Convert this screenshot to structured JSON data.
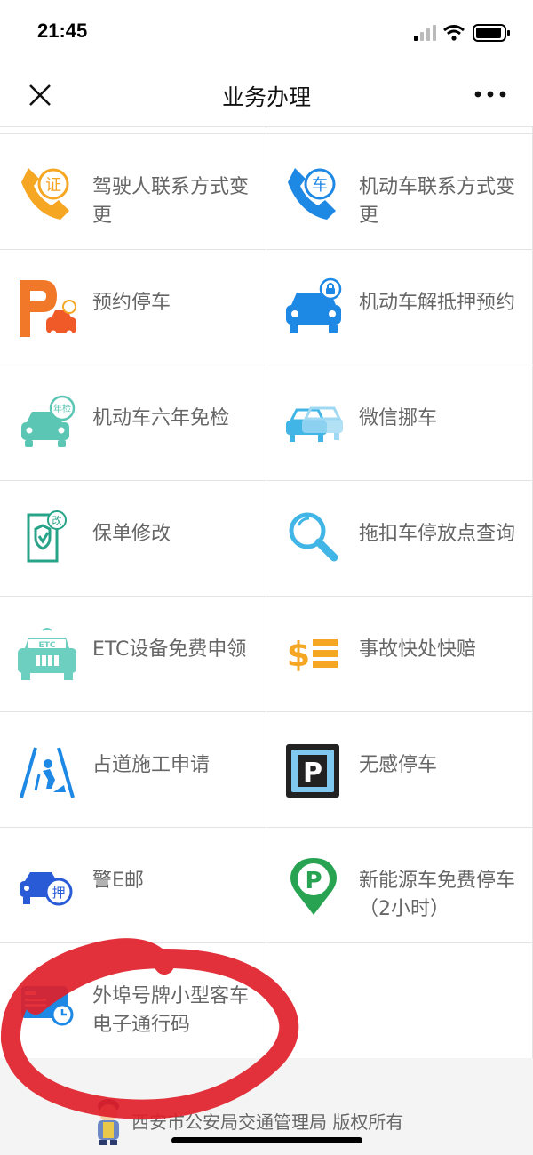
{
  "status_bar": {
    "time": "21:45"
  },
  "nav": {
    "title": "业务办理"
  },
  "services": [
    {
      "label": "驾驶人联系方式变更",
      "icon": "phone-id-icon"
    },
    {
      "label": "机动车联系方式变更",
      "icon": "phone-car-icon"
    },
    {
      "label": "预约停车",
      "icon": "parking-reserve-icon"
    },
    {
      "label": "机动车解抵押预约",
      "icon": "car-unlock-icon"
    },
    {
      "label": "机动车六年免检",
      "icon": "car-inspection-icon",
      "badge": "年检"
    },
    {
      "label": "微信挪车",
      "icon": "car-move-icon"
    },
    {
      "label": "保单修改",
      "icon": "policy-edit-icon",
      "badge": "改"
    },
    {
      "label": "拖扣车停放点查询",
      "icon": "search-magnifier-icon"
    },
    {
      "label": "ETC设备免费申领",
      "icon": "etc-car-icon",
      "badge": "ETC"
    },
    {
      "label": "事故快处快赔",
      "icon": "dollar-claim-icon"
    },
    {
      "label": "占道施工申请",
      "icon": "road-work-icon"
    },
    {
      "label": "无感停车",
      "icon": "parking-p-icon"
    },
    {
      "label": "警E邮",
      "icon": "car-mail-icon",
      "badge": "押"
    },
    {
      "label": "新能源车免费停车（2小时）",
      "icon": "green-parking-icon"
    },
    {
      "label": "外埠号牌小型客车电子通行码",
      "icon": "pass-card-clock-icon"
    }
  ],
  "footer": {
    "text": "西安市公安局交通管理局 版权所有"
  },
  "colors": {
    "orange": "#f5a623",
    "blue": "#1e88e5",
    "teal": "#5cc6b4",
    "red-annotation": "#e0202a",
    "light-blue": "#41b6e6"
  }
}
